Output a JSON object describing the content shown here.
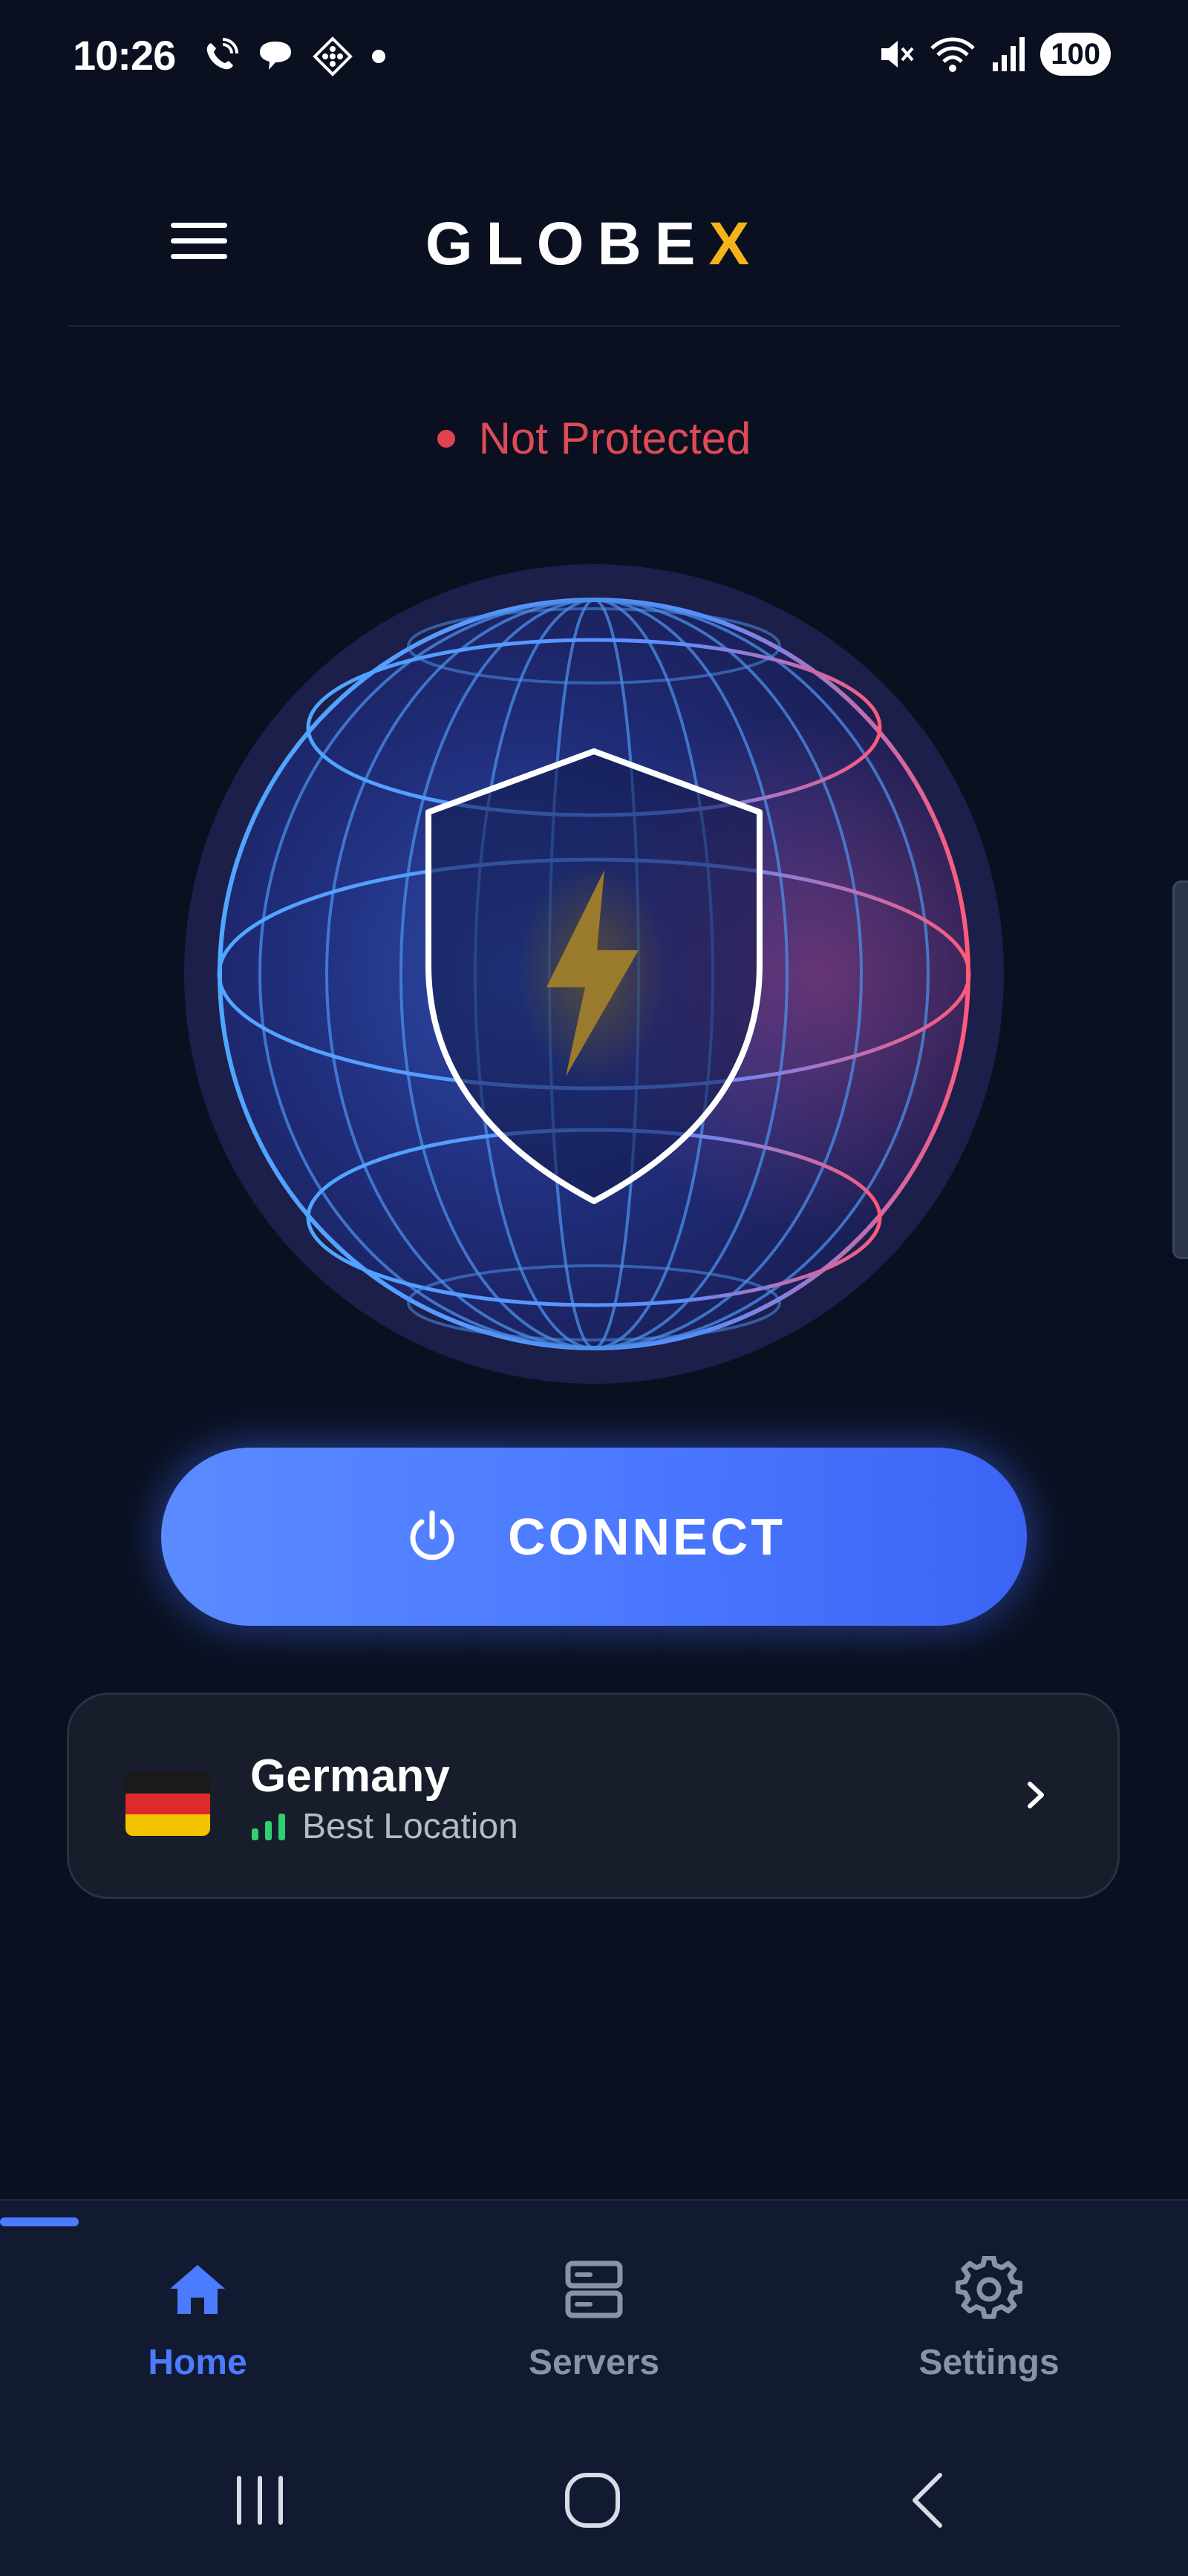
{
  "status_bar": {
    "time": "10:26",
    "battery": "100",
    "left_icons": [
      "phone-call-icon",
      "chat-bubble-icon",
      "app-diamond-icon",
      "notification-dot-icon"
    ],
    "right_icons": [
      "mute-icon",
      "wifi-icon",
      "signal-icon"
    ]
  },
  "header": {
    "brand_main": "GLOBE",
    "brand_accent": "X",
    "brand_accent_color": "#f5b21a",
    "menu_icon": "hamburger-menu-icon"
  },
  "protection": {
    "status_text": "Not Protected",
    "status_color": "#e04a56"
  },
  "globe": {
    "shield_icon": "shield-icon",
    "bolt_icon": "lightning-bolt-icon"
  },
  "connect": {
    "label": "CONNECT",
    "icon": "power-icon",
    "color": "#4b78ff"
  },
  "location": {
    "country": "Germany",
    "subtitle": "Best Location",
    "flag_icon": "germany-flag-icon",
    "signal_icon": "signal-strength-icon"
  },
  "bottom_nav": {
    "items": [
      {
        "label": "Home",
        "icon": "home-icon",
        "active": true
      },
      {
        "label": "Servers",
        "icon": "servers-icon",
        "active": false
      },
      {
        "label": "Settings",
        "icon": "gear-icon",
        "active": false
      }
    ],
    "active_color": "#4b7bff",
    "inactive_color": "#8a93a6"
  },
  "system_nav": {
    "buttons": [
      "recents-button",
      "home-button",
      "back-button"
    ]
  }
}
